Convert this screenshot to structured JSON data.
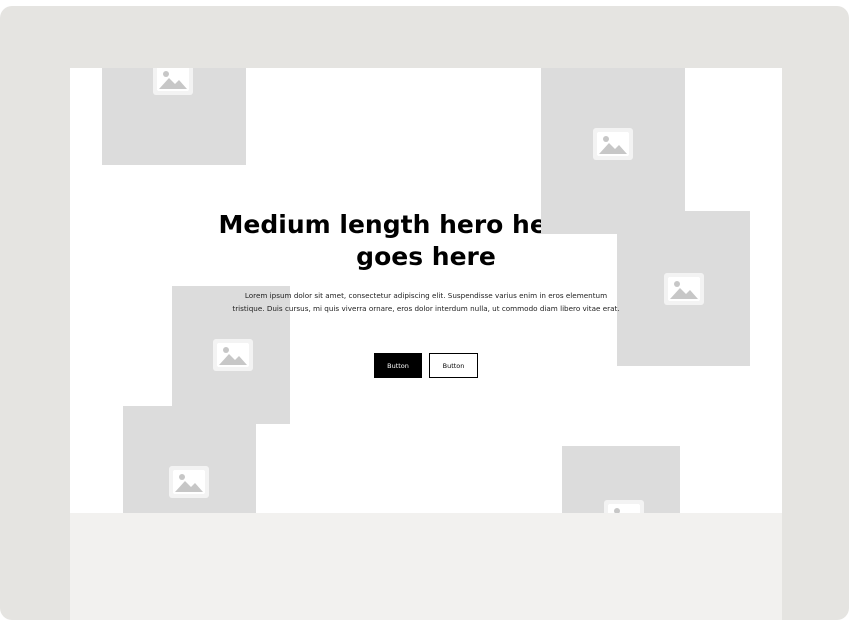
{
  "hero": {
    "headline": "Medium length hero headline goes here",
    "body": "Lorem ipsum dolor sit amet, consectetur adipiscing elit. Suspendisse varius enim in eros elementum tristique. Duis cursus, mi quis viverra ornare, eros dolor interdum nulla, ut commodo diam libero vitae erat.",
    "primary_button": "Button",
    "secondary_button": "Button"
  },
  "placeholders": [
    {
      "icon": "image-placeholder-icon"
    },
    {
      "icon": "image-placeholder-icon"
    },
    {
      "icon": "image-placeholder-icon"
    },
    {
      "icon": "image-placeholder-icon"
    },
    {
      "icon": "image-placeholder-icon"
    },
    {
      "icon": "image-placeholder-icon"
    }
  ],
  "colors": {
    "frame": "#e5e4e1",
    "canvas": "#ffffff",
    "placeholder": "#dcdcdc",
    "primary_button": "#000000"
  }
}
